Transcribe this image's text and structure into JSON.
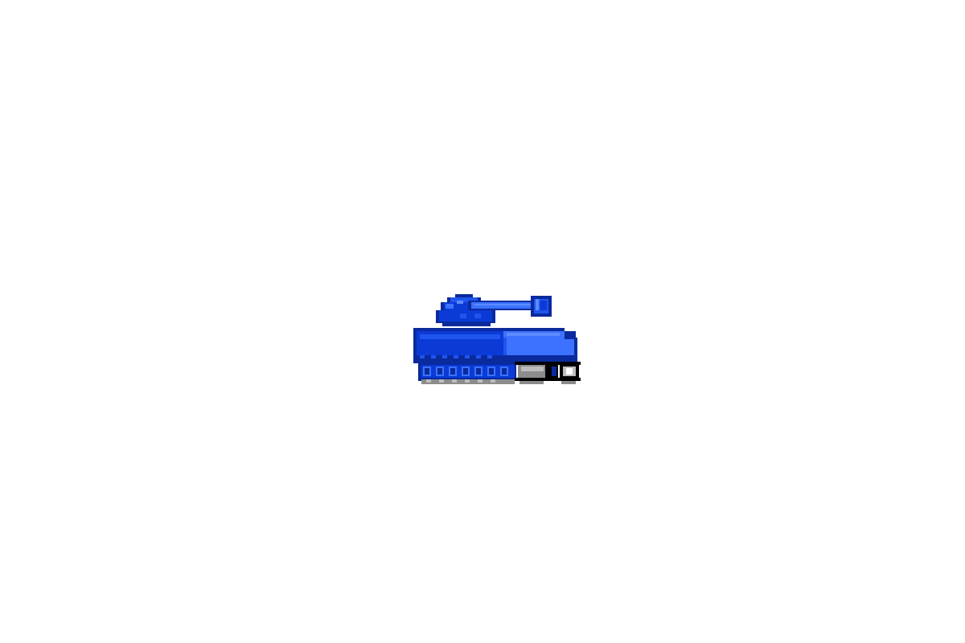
{
  "scene": {
    "background": "#ffffff",
    "sprite": {
      "icon": "tank-icon",
      "palette": {
        "outline": "#0a2a9e",
        "body_dark": "#0b3ad6",
        "body_mid": "#1f55ee",
        "body_light": "#3c72ff",
        "highlight": "#5d8bff",
        "track_gray": "#8c8c8c",
        "track_light": "#bdbdbd",
        "black": "#000000"
      }
    }
  }
}
